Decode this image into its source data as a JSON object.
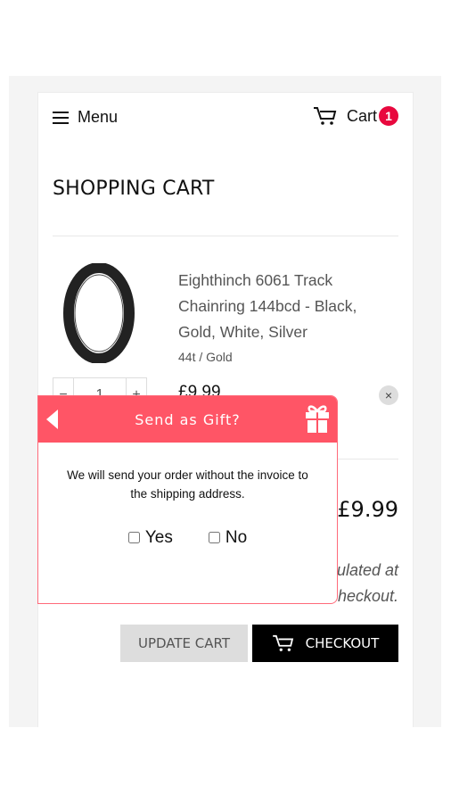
{
  "header": {
    "menu_label": "Menu",
    "cart_label": "Cart",
    "cart_count": "1"
  },
  "page_title": "SHOPPING CART",
  "item": {
    "name": "Eighthinch 6061 Track Chainring 144bcd - Black, Gold, White, Silver",
    "variant": "44t / Gold",
    "quantity": "1",
    "price": "£9.99",
    "qty_minus": "−",
    "qty_plus": "+",
    "remove_icon": "×"
  },
  "summary": {
    "total": "£9.99",
    "note": "Shipping & taxes calculated at checkout."
  },
  "buttons": {
    "update": "UPDATE CART",
    "checkout": "CHECKOUT"
  },
  "popup": {
    "title": "Send as Gift?",
    "message": "We will send your order without the invoice to the shipping address.",
    "yes": "Yes",
    "no": "No",
    "color": "#ff5566"
  },
  "colors": {
    "badge": "#e8083e",
    "checkout_bg": "#000000"
  }
}
